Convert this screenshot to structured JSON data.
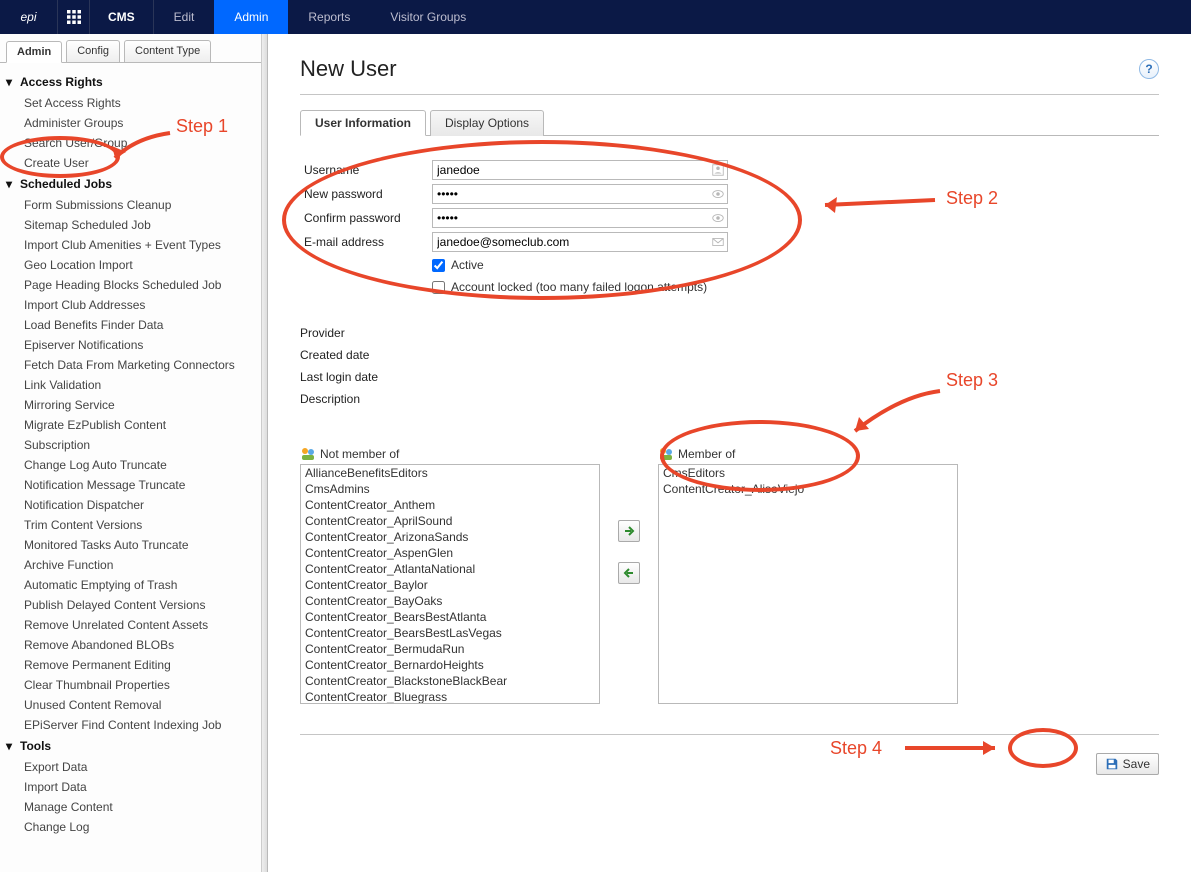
{
  "topnav": {
    "logo": "epi",
    "cms": "CMS",
    "items": [
      "Edit",
      "Admin",
      "Reports",
      "Visitor Groups"
    ],
    "active_index": 1
  },
  "side_tabs": {
    "items": [
      "Admin",
      "Config",
      "Content Type"
    ],
    "active_index": 0
  },
  "tree": {
    "sections": [
      {
        "title": "Access Rights",
        "items": [
          "Set Access Rights",
          "Administer Groups",
          "Search User/Group",
          "Create User"
        ]
      },
      {
        "title": "Scheduled Jobs",
        "items": [
          "Form Submissions Cleanup",
          "Sitemap Scheduled Job",
          "Import Club Amenities + Event Types",
          "Geo Location Import",
          "Page Heading Blocks Scheduled Job",
          "Import Club Addresses",
          "Load Benefits Finder Data",
          "Episerver Notifications",
          "Fetch Data From Marketing Connectors",
          "Link Validation",
          "Mirroring Service",
          "Migrate EzPublish Content",
          "Subscription",
          "Change Log Auto Truncate",
          "Notification Message Truncate",
          "Notification Dispatcher",
          "Trim Content Versions",
          "Monitored Tasks Auto Truncate",
          "Archive Function",
          "Automatic Emptying of Trash",
          "Publish Delayed Content Versions",
          "Remove Unrelated Content Assets",
          "Remove Abandoned BLOBs",
          "Remove Permanent Editing",
          "Clear Thumbnail Properties",
          "Unused Content Removal",
          "EPiServer Find Content Indexing Job"
        ]
      },
      {
        "title": "Tools",
        "items": [
          "Export Data",
          "Import Data",
          "Manage Content",
          "Change Log"
        ]
      }
    ]
  },
  "page": {
    "title": "New User",
    "tabs": [
      "User Information",
      "Display Options"
    ],
    "active_tab_index": 0
  },
  "form": {
    "username_label": "Username",
    "username_value": "janedoe",
    "newpw_label": "New password",
    "newpw_value": "•••••",
    "confirmpw_label": "Confirm password",
    "confirmpw_value": "•••••",
    "email_label": "E-mail address",
    "email_value": "janedoe@someclub.com",
    "active_label": "Active",
    "active_checked": true,
    "locked_label": "Account locked (too many failed logon attempts)",
    "locked_checked": false
  },
  "meta": {
    "provider": "Provider",
    "created": "Created date",
    "lastlogin": "Last login date",
    "description": "Description"
  },
  "groups": {
    "not_member_label": "Not member of",
    "member_label": "Member of",
    "not_member": [
      "AllianceBenefitsEditors",
      "CmsAdmins",
      "ContentCreator_Anthem",
      "ContentCreator_AprilSound",
      "ContentCreator_ArizonaSands",
      "ContentCreator_AspenGlen",
      "ContentCreator_AtlantaNational",
      "ContentCreator_Baylor",
      "ContentCreator_BayOaks",
      "ContentCreator_BearsBestAtlanta",
      "ContentCreator_BearsBestLasVegas",
      "ContentCreator_BermudaRun",
      "ContentCreator_BernardoHeights",
      "ContentCreator_BlackstoneBlackBear",
      "ContentCreator_Bluegrass"
    ],
    "member": [
      "CmsEditors",
      "ContentCreator_AlisoViejo"
    ]
  },
  "buttons": {
    "save": "Save"
  },
  "annotations": {
    "step1": "Step 1",
    "step2": "Step 2",
    "step3": "Step 3",
    "step4": "Step 4"
  }
}
